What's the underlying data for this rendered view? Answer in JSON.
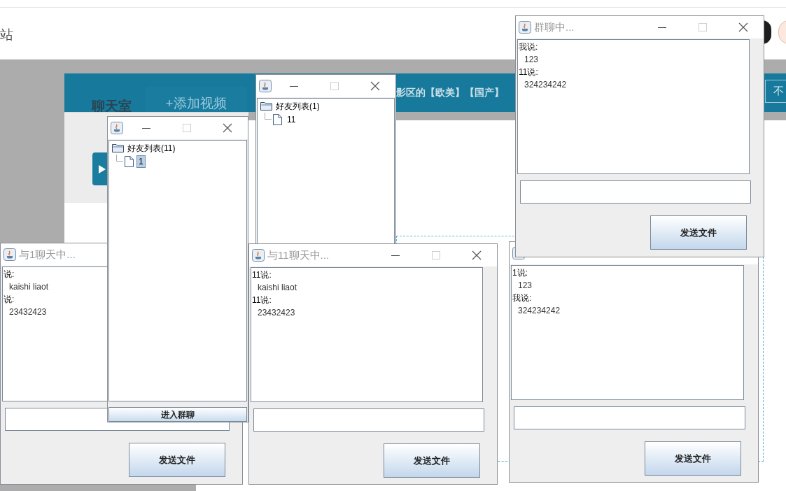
{
  "page": {
    "site_link": "站",
    "section_title": "聊天室",
    "add_video_button": "+添加视频",
    "banner_text": "影区的【欧美】【国产】",
    "banner_button": "不"
  },
  "windows": [
    {
      "kind": "tree",
      "title_controls": true,
      "tree": [
        {
          "label": "好友列表(1)",
          "selected": false,
          "children": [
            {
              "label": "11",
              "selected": false
            }
          ]
        }
      ]
    },
    {
      "kind": "chat",
      "title": "与1聊天中...",
      "transcript": [
        {
          "kind": "speaker",
          "text": "说:"
        },
        {
          "kind": "message",
          "text": "kaishi liaot"
        },
        {
          "kind": "speaker",
          "text": "说:"
        },
        {
          "kind": "message",
          "text": "23432423"
        }
      ],
      "button": "发送文件"
    },
    {
      "kind": "tree",
      "title_controls": true,
      "tree": [
        {
          "label": "好友列表(11)",
          "selected": false,
          "children": [
            {
              "label": "1",
              "selected": true
            }
          ]
        }
      ],
      "button": "进入群聊"
    },
    {
      "kind": "chat",
      "title": "与11聊天中...",
      "title_controls": true,
      "transcript": [
        {
          "kind": "speaker",
          "text": "11说:"
        },
        {
          "kind": "message",
          "text": "kaishi liaot"
        },
        {
          "kind": "speaker",
          "text": "11说:"
        },
        {
          "kind": "message",
          "text": "23432423"
        }
      ],
      "button": "发送文件"
    },
    {
      "kind": "chat",
      "title": "群聊中...",
      "title_controls": true,
      "transcript": [
        {
          "kind": "speaker",
          "text": "我说:"
        },
        {
          "kind": "message",
          "text": "123"
        },
        {
          "kind": "speaker",
          "text": "11说:"
        },
        {
          "kind": "message",
          "text": "324234242"
        }
      ],
      "button": "发送文件"
    },
    {
      "kind": "chat",
      "transcript": [
        {
          "kind": "speaker",
          "text": "1说:"
        },
        {
          "kind": "message",
          "text": "123"
        },
        {
          "kind": "speaker",
          "text": "我说:"
        },
        {
          "kind": "message",
          "text": "324234242"
        }
      ],
      "button": "发送文件"
    }
  ]
}
